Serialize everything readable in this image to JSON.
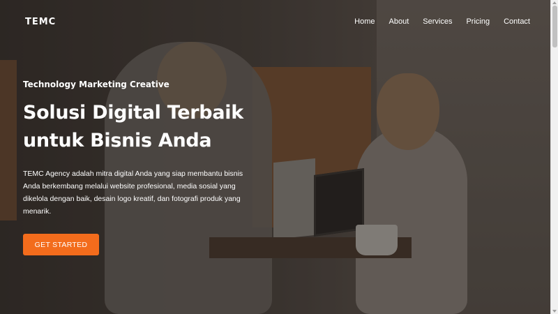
{
  "brand": {
    "logo_text": "TEMC"
  },
  "nav": {
    "items": [
      {
        "label": "Home"
      },
      {
        "label": "About"
      },
      {
        "label": "Services"
      },
      {
        "label": "Pricing"
      },
      {
        "label": "Contact"
      }
    ]
  },
  "hero": {
    "tagline": "Technology Marketing Creative",
    "headline_line1": "Solusi Digital Terbaik",
    "headline_line2": "untuk Bisnis Anda",
    "description": "TEMC Agency adalah mitra digital Anda yang siap membantu bisnis Anda berkembang melalui website profesional, media sosial yang dikelola dengan baik, desain logo kreatif, dan fotografi produk yang menarik.",
    "cta_label": "GET STARTED",
    "background_image": "people-with-laptop-cafe"
  },
  "colors": {
    "accent": "#f36c1c",
    "text": "#ffffff",
    "overlay": "#2b2522"
  }
}
